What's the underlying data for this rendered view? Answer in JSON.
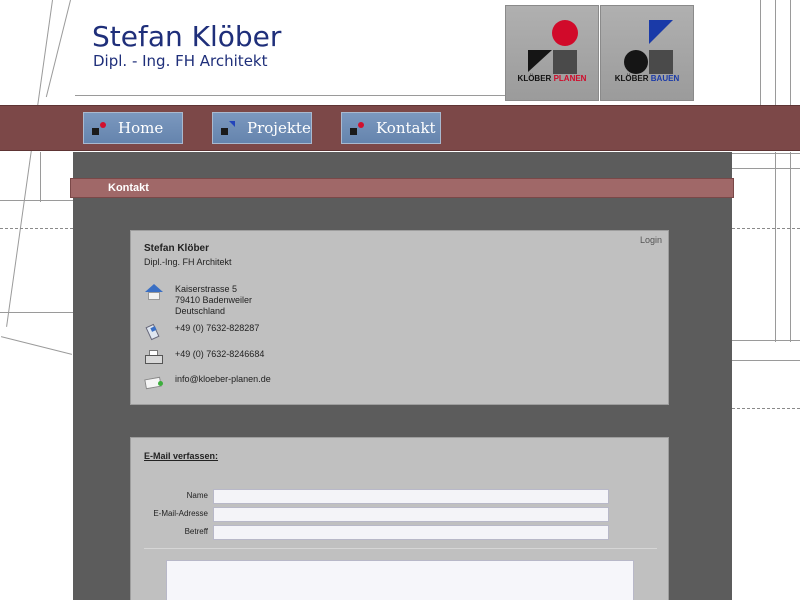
{
  "header": {
    "brand_name": "Stefan Klöber",
    "brand_subtitle": "Dipl. - Ing. FH Architekt",
    "logos": [
      {
        "prefix": "KLÖBER",
        "accent": "PLANEN"
      },
      {
        "prefix": "KLÖBER",
        "accent": "BAUEN"
      }
    ]
  },
  "nav": {
    "items": [
      {
        "label": "Home"
      },
      {
        "label": "Projekte"
      },
      {
        "label": "Kontakt"
      }
    ]
  },
  "section": {
    "title": "Kontakt"
  },
  "contact_card": {
    "login": "Login",
    "name": "Stefan Klöber",
    "title": "Dipl.-Ing. FH Architekt",
    "address_line1": "Kaiserstrasse 5",
    "address_line2": "79410 Badenweiler",
    "address_line3": "Deutschland",
    "phone": "+49 (0) 7632-828287",
    "fax": "+49 (0) 7632-8246684",
    "email": "info@kloeber-planen.de"
  },
  "mail_form": {
    "title": "E-Mail verfassen:",
    "fields": [
      {
        "label": "Name",
        "value": ""
      },
      {
        "label": "E-Mail-Adresse",
        "value": ""
      },
      {
        "label": "Betreff",
        "value": ""
      }
    ],
    "message": ""
  },
  "colors": {
    "brand_blue": "#1f2f7a",
    "navbar": "#7c4848",
    "nav_button": "#6f8db5",
    "section_bar": "#a06868",
    "content_bg": "#5c5c5c",
    "card_bg": "#c0c0c0",
    "logo_red": "#d10a2a",
    "logo_blue": "#1a3aa8"
  }
}
